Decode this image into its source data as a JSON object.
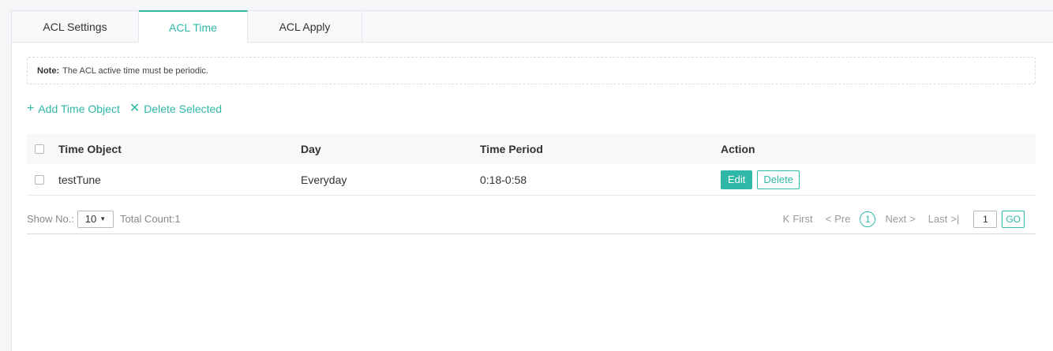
{
  "tabs": [
    {
      "label": "ACL Settings",
      "active": false
    },
    {
      "label": "ACL Time",
      "active": true
    },
    {
      "label": "ACL Apply",
      "active": false
    }
  ],
  "note": {
    "label": "Note:",
    "text": "The ACL active time must be periodic."
  },
  "toolbar": {
    "add_icon": "+",
    "add_label": "Add Time Object",
    "delete_icon": "✕",
    "delete_label": "Delete Selected"
  },
  "table": {
    "headers": [
      "Time Object",
      "Day",
      "Time Period",
      "Action"
    ],
    "rows": [
      {
        "time_object": "testTune",
        "day": "Everyday",
        "time_period": "0:18-0:58",
        "edit_label": "Edit",
        "delete_label": "Delete"
      }
    ]
  },
  "pagination": {
    "show_label": "Show No.:",
    "show_value": "10",
    "total_label": "Total Count:1",
    "first_icon": "K",
    "first_label": "First",
    "pre_icon": "<",
    "pre_label": "Pre",
    "current_page": "1",
    "next_label": "Next",
    "next_icon": ">",
    "last_label": "Last",
    "last_icon": ">|",
    "page_input": "1",
    "go_label": "GO"
  },
  "colors": {
    "accent": "#2fb7a8",
    "border": "#e3e6ea",
    "header_bg": "#f7f8fa"
  }
}
